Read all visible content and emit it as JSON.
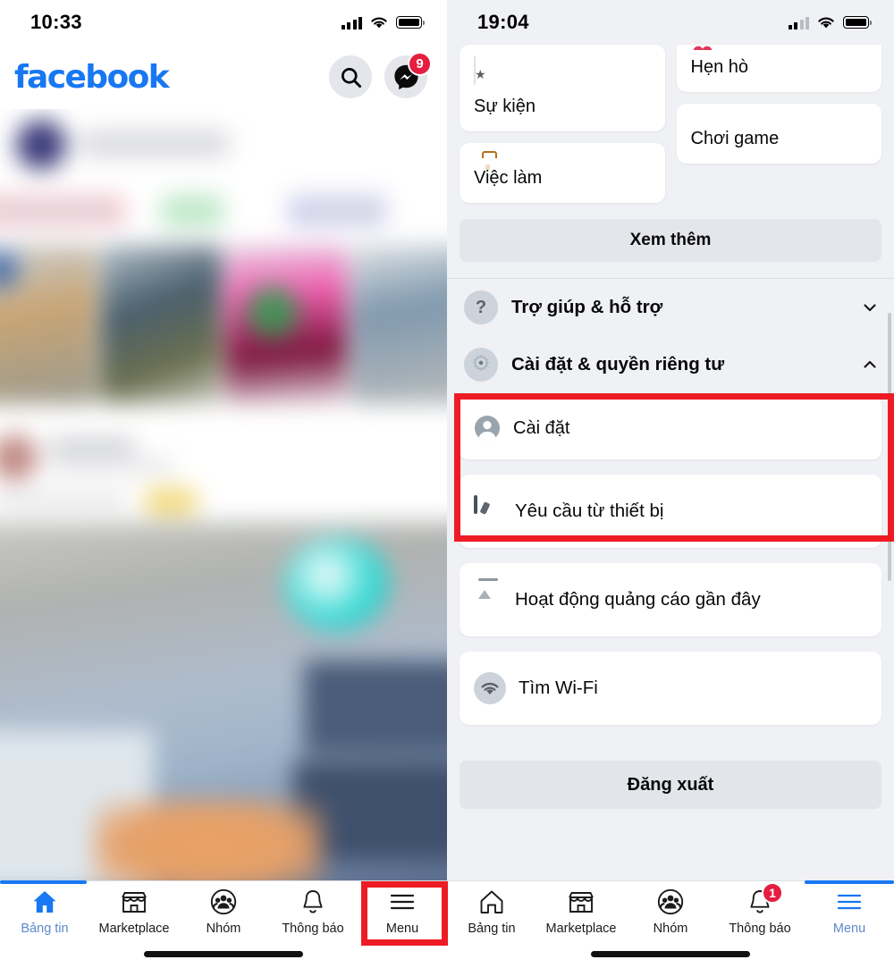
{
  "left": {
    "status": {
      "time": "10:33",
      "signal_icon": "cellular-bars-icon",
      "wifi_icon": "wifi-icon",
      "battery_icon": "battery-icon"
    },
    "header": {
      "logo": "facebook",
      "search_icon": "search-icon",
      "messenger_icon": "messenger-icon",
      "messenger_badge": "9"
    },
    "tabbar": {
      "items": [
        {
          "label": "Bảng tin",
          "icon": "home-icon",
          "active": true,
          "badge": ""
        },
        {
          "label": "Marketplace",
          "icon": "storefront-icon",
          "active": false,
          "badge": ""
        },
        {
          "label": "Nhóm",
          "icon": "groups-icon",
          "active": false,
          "badge": ""
        },
        {
          "label": "Thông báo",
          "icon": "bell-icon",
          "active": false,
          "badge": ""
        },
        {
          "label": "Menu",
          "icon": "hamburger-icon",
          "active": false,
          "badge": ""
        }
      ]
    }
  },
  "right": {
    "status": {
      "time": "19:04",
      "signal_icon": "cellular-bars-icon",
      "wifi_icon": "wifi-icon",
      "battery_icon": "battery-icon"
    },
    "shortcuts": {
      "left_column": [
        {
          "label": "Sự kiện",
          "icon": "calendar-star-icon"
        },
        {
          "label": "Việc làm",
          "icon": "briefcase-icon"
        }
      ],
      "right_column": [
        {
          "label": "Hẹn hò",
          "icon": "heart-icon"
        },
        {
          "label": "Chơi game",
          "icon": "gaming-icon"
        }
      ]
    },
    "see_more": "Xem thêm",
    "accordions": [
      {
        "label": "Trợ giúp & hỗ trợ",
        "icon": "question-circle-icon",
        "chevron": "chevron-down-icon",
        "expanded": false
      },
      {
        "label": "Cài đặt & quyền riêng tư",
        "icon": "gear-icon",
        "chevron": "chevron-up-icon",
        "expanded": true
      }
    ],
    "settings_child": {
      "label": "Cài đặt",
      "icon": "account-circle-icon"
    },
    "list_items": [
      {
        "label": "Yêu cầu từ thiết bị",
        "icon": "device-key-icon"
      },
      {
        "label": "Hoạt động quảng cáo gần đây",
        "icon": "ad-activity-icon"
      },
      {
        "label": "Tìm Wi-Fi",
        "icon": "wifi-circle-icon"
      }
    ],
    "logout": "Đăng xuất",
    "tabbar": {
      "items": [
        {
          "label": "Bảng tin",
          "icon": "home-icon",
          "active": false,
          "badge": ""
        },
        {
          "label": "Marketplace",
          "icon": "storefront-icon",
          "active": false,
          "badge": ""
        },
        {
          "label": "Nhóm",
          "icon": "groups-icon",
          "active": false,
          "badge": ""
        },
        {
          "label": "Thông báo",
          "icon": "bell-icon",
          "active": false,
          "badge": "1"
        },
        {
          "label": "Menu",
          "icon": "hamburger-icon",
          "active": true,
          "badge": ""
        }
      ]
    }
  },
  "annotations": {
    "accent_color": "#ED1C24",
    "boxes": [
      {
        "name": "settings-privacy-highlight"
      },
      {
        "name": "menu-tab-highlight"
      }
    ]
  }
}
